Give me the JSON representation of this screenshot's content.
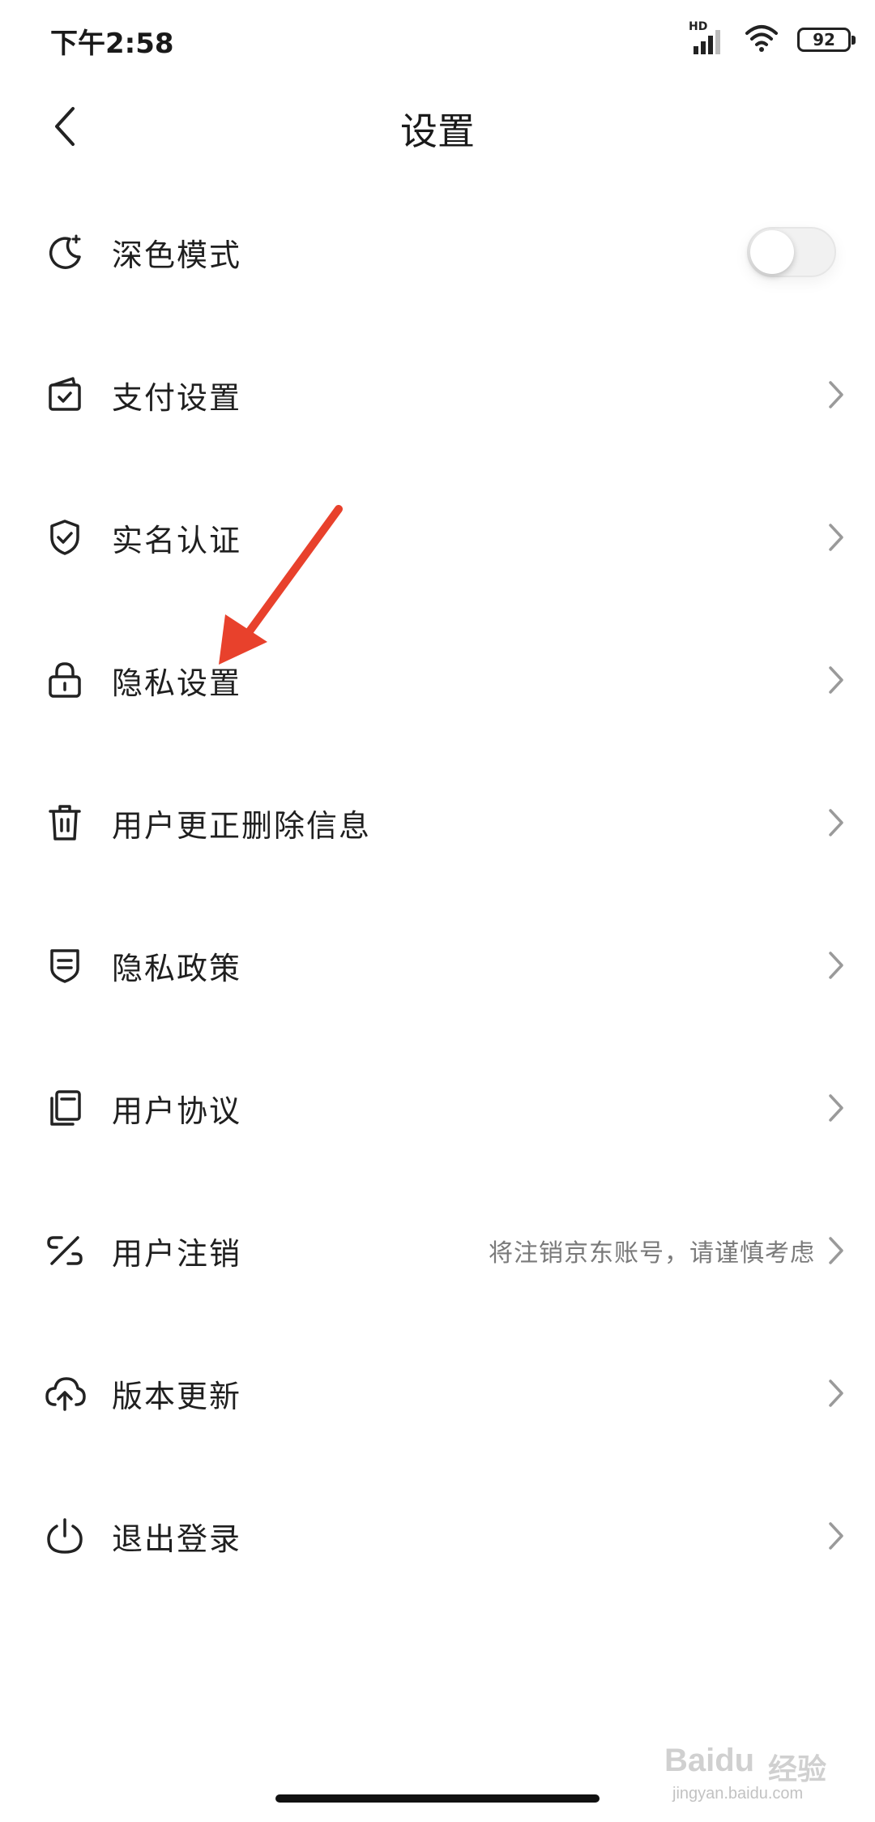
{
  "status_bar": {
    "time": "下午2:58",
    "network_label": "HD",
    "battery_level": "92"
  },
  "header": {
    "title": "设置"
  },
  "settings": {
    "items": [
      {
        "label": "深色模式",
        "icon": "moon-icon",
        "control": "toggle",
        "toggle_on": false
      },
      {
        "label": "支付设置",
        "icon": "wallet-check-icon",
        "control": "chevron"
      },
      {
        "label": "实名认证",
        "icon": "shield-check-icon",
        "control": "chevron"
      },
      {
        "label": "隐私设置",
        "icon": "lock-icon",
        "control": "chevron"
      },
      {
        "label": "用户更正删除信息",
        "icon": "trash-icon",
        "control": "chevron"
      },
      {
        "label": "隐私政策",
        "icon": "policy-shield-icon",
        "control": "chevron"
      },
      {
        "label": "用户协议",
        "icon": "document-icon",
        "control": "chevron"
      },
      {
        "label": "用户注销",
        "icon": "unlink-icon",
        "control": "chevron",
        "hint": "将注销京东账号，请谨慎考虑"
      },
      {
        "label": "版本更新",
        "icon": "cloud-upload-icon",
        "control": "chevron"
      },
      {
        "label": "退出登录",
        "icon": "power-icon",
        "control": "chevron"
      }
    ]
  },
  "annotation": {
    "arrow_color": "#e8412c",
    "points_to": "隐私设置"
  },
  "watermark": {
    "brand": "Baidu",
    "cn": "经验",
    "url": "jingyan.baidu.com"
  },
  "colors": {
    "background": "#ffffff",
    "text": "#1f1f1f",
    "hint": "#7a7a7a",
    "chevron": "#9a9a9a"
  }
}
